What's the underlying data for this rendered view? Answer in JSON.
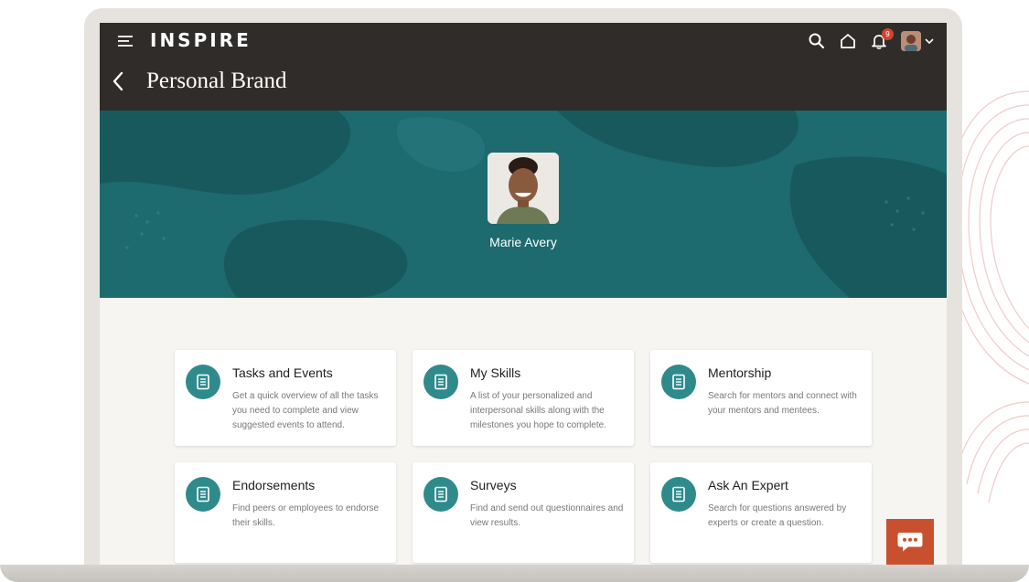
{
  "app": {
    "brand": "INSPIRE",
    "notification_count": "9"
  },
  "header": {
    "title": "Personal Brand"
  },
  "profile": {
    "name": "Marie Avery"
  },
  "cards": [
    {
      "title": "Tasks and Events",
      "description": "Get a quick overview of all the tasks you need to complete and view suggested events to attend.",
      "icon": "document-icon"
    },
    {
      "title": "My Skills",
      "description": "A list of your personalized and interpersonal skills along with the milestones you hope to complete.",
      "icon": "document-icon"
    },
    {
      "title": "Mentorship",
      "description": "Search for mentors and connect with your mentors and mentees.",
      "icon": "document-icon"
    },
    {
      "title": "Endorsements",
      "description": "Find peers or employees to endorse their skills.",
      "icon": "document-icon"
    },
    {
      "title": "Surveys",
      "description": "Find and send out questionnaires and view results.",
      "icon": "document-icon"
    },
    {
      "title": "Ask An Expert",
      "description": "Search for questions answered by experts or create a question.",
      "icon": "document-icon"
    }
  ],
  "colors": {
    "topbar": "#2f2c2a",
    "hero": "#1d6a6f",
    "card_icon": "#2f8a8c",
    "chat_button": "#c9502f",
    "badge": "#d0452f"
  }
}
